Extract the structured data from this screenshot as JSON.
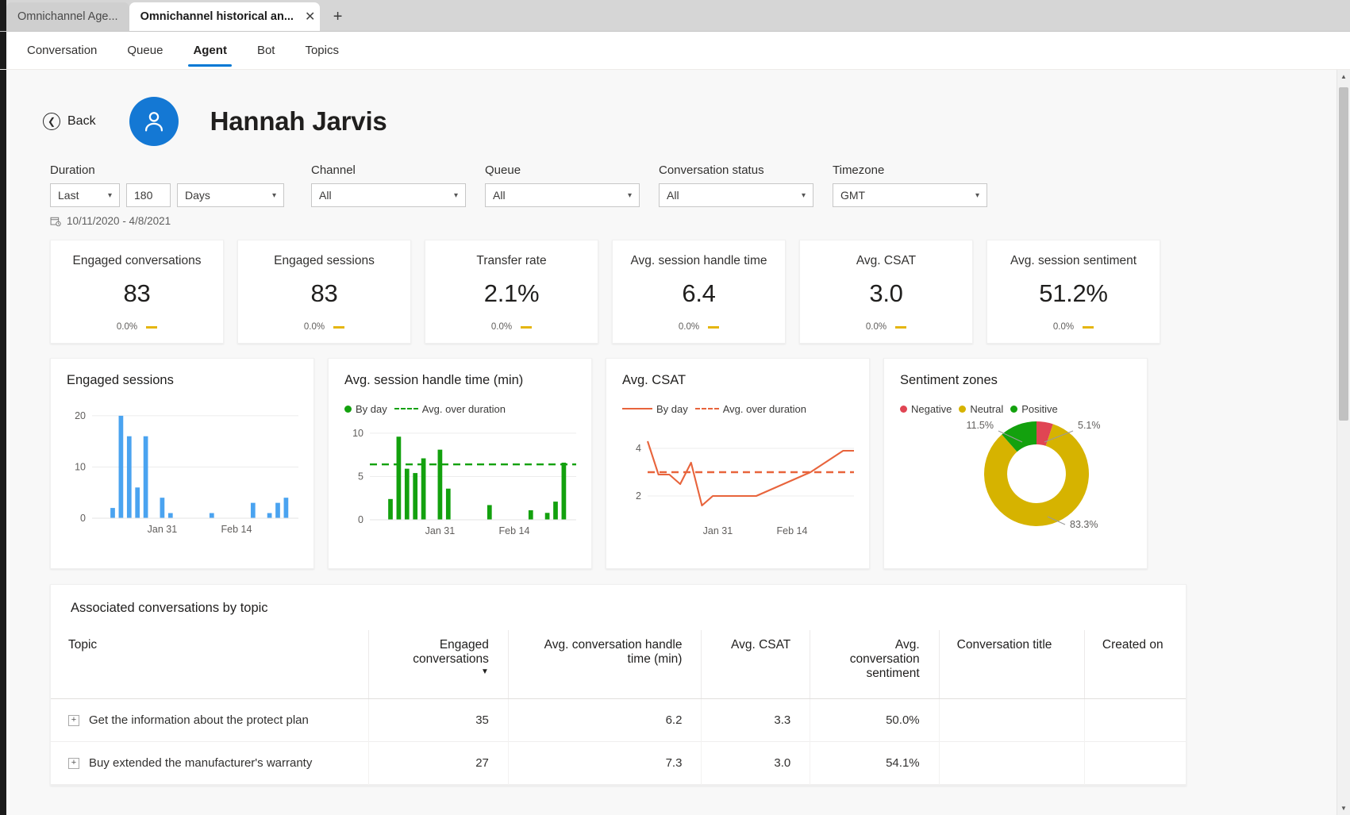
{
  "browser": {
    "tabs": [
      {
        "title": "Omnichannel Age...",
        "active": false
      },
      {
        "title": "Omnichannel historical an...",
        "active": true
      }
    ],
    "close_icon": "close-icon",
    "new_tab_icon": "plus-icon"
  },
  "app_nav": {
    "items": [
      {
        "label": "Conversation",
        "selected": false
      },
      {
        "label": "Queue",
        "selected": false
      },
      {
        "label": "Agent",
        "selected": true
      },
      {
        "label": "Bot",
        "selected": false
      },
      {
        "label": "Topics",
        "selected": false
      }
    ]
  },
  "header": {
    "back_label": "Back",
    "back_icon": "arrow-left-circle-icon",
    "avatar_icon": "person-icon",
    "agent_name": "Hannah Jarvis"
  },
  "filters": {
    "duration": {
      "label": "Duration",
      "mode": "Last",
      "amount": "180",
      "unit": "Days"
    },
    "channel": {
      "label": "Channel",
      "value": "All"
    },
    "queue": {
      "label": "Queue",
      "value": "All"
    },
    "conversation_status": {
      "label": "Conversation status",
      "value": "All"
    },
    "timezone": {
      "label": "Timezone",
      "value": "GMT"
    },
    "date_range": "10/11/2020 - 4/8/2021",
    "date_range_icon": "calendar-icon",
    "chevron_icon": "chevron-down-icon"
  },
  "kpis": [
    {
      "title": "Engaged conversations",
      "value": "83",
      "delta": "0.0%",
      "trend": "flat"
    },
    {
      "title": "Engaged sessions",
      "value": "83",
      "delta": "0.0%",
      "trend": "flat"
    },
    {
      "title": "Transfer rate",
      "value": "2.1%",
      "delta": "0.0%",
      "trend": "flat"
    },
    {
      "title": "Avg. session handle time",
      "value": "6.4",
      "delta": "0.0%",
      "trend": "flat"
    },
    {
      "title": "Avg. CSAT",
      "value": "3.0",
      "delta": "0.0%",
      "trend": "flat"
    },
    {
      "title": "Avg. session sentiment",
      "value": "51.2%",
      "delta": "0.0%",
      "trend": "flat"
    }
  ],
  "colors": {
    "accent_blue": "#0078d4",
    "bar_blue": "#4aa3f0",
    "bar_green": "#13a10e",
    "line_orange": "#e8643c",
    "neutral_yellow": "#d6b300",
    "negative_red": "#e04553",
    "positive_green": "#13a10e",
    "kpi_flat": "#e5b611"
  },
  "chart_data": [
    {
      "id": "engaged-sessions-chart",
      "type": "bar",
      "title": "Engaged sessions",
      "xlabel": "",
      "ylabel": "",
      "ylim": [
        0,
        22
      ],
      "yticks": [
        0,
        10,
        20
      ],
      "grid": true,
      "xtick_labels": [
        "Jan 31",
        "Feb 14"
      ],
      "xtick_positions": [
        8,
        17
      ],
      "categories": [
        "1",
        "2",
        "3",
        "4",
        "5",
        "6",
        "7",
        "8",
        "9",
        "10",
        "11",
        "12",
        "13",
        "14",
        "15",
        "16",
        "17",
        "18",
        "19",
        "20",
        "21",
        "22",
        "23",
        "24",
        "25"
      ],
      "values": [
        0,
        0,
        2,
        20,
        16,
        6,
        16,
        0,
        4,
        1,
        0,
        0,
        0,
        0,
        1,
        0,
        0,
        0,
        0,
        3,
        0,
        1,
        3,
        4,
        0
      ]
    },
    {
      "id": "avg-session-handle-time-chart",
      "type": "bar",
      "title": "Avg. session handle time (min)",
      "xlabel": "",
      "ylabel": "",
      "ylim": [
        0,
        11
      ],
      "yticks": [
        0,
        5,
        10
      ],
      "grid": true,
      "xtick_labels": [
        "Jan 31",
        "Feb 14"
      ],
      "xtick_positions": [
        8,
        17
      ],
      "legend": [
        {
          "label": "By day",
          "marker": "dot",
          "color": "#13a10e"
        },
        {
          "label": "Avg. over duration",
          "marker": "dashed-line",
          "color": "#13a10e"
        }
      ],
      "avg_over_duration": 6.4,
      "categories": [
        "1",
        "2",
        "3",
        "4",
        "5",
        "6",
        "7",
        "8",
        "9",
        "10",
        "11",
        "12",
        "13",
        "14",
        "15",
        "16",
        "17",
        "18",
        "19",
        "20",
        "21",
        "22",
        "23",
        "24",
        "25"
      ],
      "values": [
        0,
        0,
        2.4,
        9.6,
        5.9,
        5.4,
        7.1,
        0,
        8.1,
        3.6,
        0,
        0,
        0,
        0,
        1.7,
        0,
        0,
        0,
        0,
        1.1,
        0,
        0.8,
        2.1,
        6.6,
        0
      ]
    },
    {
      "id": "avg-csat-chart",
      "type": "line",
      "title": "Avg. CSAT",
      "xlabel": "",
      "ylabel": "",
      "ylim": [
        1,
        4.6
      ],
      "yticks": [
        2,
        4
      ],
      "grid": true,
      "xtick_labels": [
        "Jan 31",
        "Feb 14"
      ],
      "xtick_positions": [
        8,
        17
      ],
      "legend": [
        {
          "label": "By day",
          "marker": "solid-line",
          "color": "#e8643c"
        },
        {
          "label": "Avg. over duration",
          "marker": "dashed-line",
          "color": "#e8643c"
        }
      ],
      "avg_over_duration": 3.0,
      "x": [
        "1",
        "2",
        "3",
        "4",
        "5",
        "6",
        "7",
        "8",
        "9",
        "10",
        "11",
        "12",
        "13",
        "14",
        "15",
        "16",
        "17",
        "18",
        "19",
        "20"
      ],
      "values": [
        4.3,
        2.9,
        2.9,
        2.5,
        3.4,
        1.6,
        2.0,
        2.0,
        2.0,
        2.0,
        2.0,
        2.2,
        2.4,
        2.6,
        2.8,
        3.0,
        3.3,
        3.6,
        3.9,
        3.9
      ]
    },
    {
      "id": "sentiment-zones-chart",
      "type": "pie",
      "title": "Sentiment zones",
      "donut": true,
      "legend_position": "top",
      "labels": [
        "Negative",
        "Neutral",
        "Positive"
      ],
      "values": [
        5.1,
        83.3,
        11.5
      ],
      "value_labels": [
        "5.1%",
        "83.3%",
        "11.5%"
      ],
      "colors": [
        "#e04553",
        "#d6b300",
        "#13a10e"
      ]
    }
  ],
  "table": {
    "title": "Associated conversations by topic",
    "sort_column": "Engaged conversations",
    "sort_icon": "sort-descending-caret",
    "expander_icon": "plus-box-icon",
    "columns": [
      "Topic",
      "Engaged conversations",
      "Avg. conversation handle time (min)",
      "Avg. CSAT",
      "Avg. conversation sentiment",
      "Conversation title",
      "Created on"
    ],
    "rows": [
      {
        "topic": "Get the information about the protect plan",
        "engaged_conversations": "35",
        "avg_handle_time": "6.2",
        "avg_csat": "3.3",
        "avg_sentiment": "50.0%",
        "conversation_title": "",
        "created_on": ""
      },
      {
        "topic": "Buy extended the manufacturer's warranty",
        "engaged_conversations": "27",
        "avg_handle_time": "7.3",
        "avg_csat": "3.0",
        "avg_sentiment": "54.1%",
        "conversation_title": "",
        "created_on": ""
      }
    ]
  },
  "scrollbar": {
    "up_icon": "chevron-up-icon",
    "down_icon": "chevron-down-icon"
  }
}
